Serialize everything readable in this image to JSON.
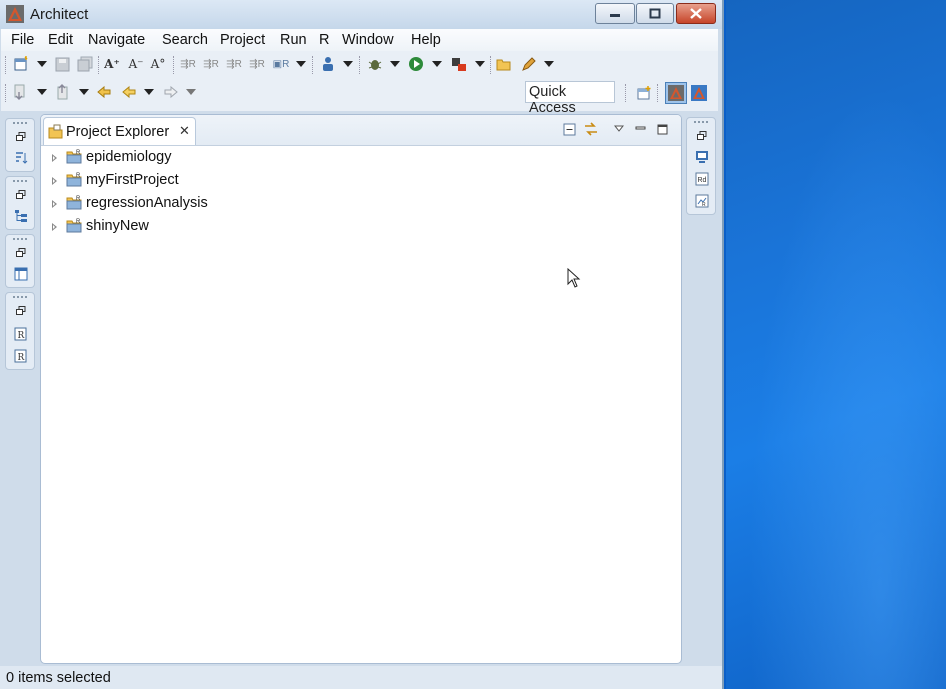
{
  "window": {
    "title": "Architect",
    "icon": "architect-logo-icon"
  },
  "menubar": {
    "items": [
      "File",
      "Edit",
      "Navigate",
      "Search",
      "Project",
      "Run",
      "R",
      "Window",
      "Help"
    ]
  },
  "toolbar": {
    "quick_access_label": "Quick Access"
  },
  "project_explorer": {
    "tab_label": "Project Explorer",
    "projects": [
      "epidemiology",
      "myFirstProject",
      "regressionAnalysis",
      "shinyNew"
    ]
  },
  "status_bar": {
    "text": "0 items selected"
  },
  "colors": {
    "accent": "#d3572e",
    "window_bg": "#cfdcea",
    "desktop": "#1a74d8"
  }
}
